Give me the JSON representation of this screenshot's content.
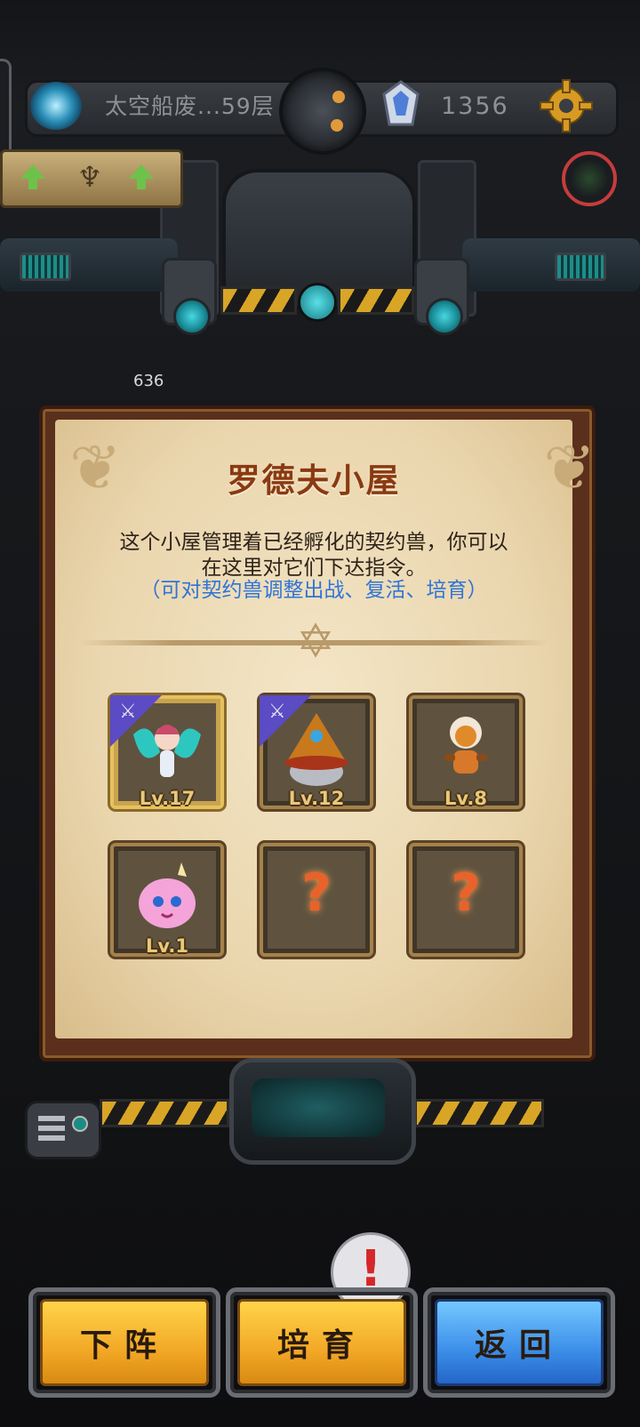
{
  "hud": {
    "floor_label": "太空船废...59层",
    "gold_amount": "1356",
    "scene_hp_number": "636"
  },
  "modal": {
    "title": "罗德夫小屋",
    "description_line1": "这个小屋管理着已经孵化的契约兽，你可以",
    "description_line2": "在这里对它们下达指令。",
    "hint": "（可对契约兽调整出战、复活、培育）"
  },
  "monsters": [
    {
      "name": "fairy-wing-monster",
      "level": "Lv.17",
      "deployed": true,
      "selected": true,
      "color": "#2ec7c0"
    },
    {
      "name": "wizard-hat-monster",
      "level": "Lv.12",
      "deployed": true,
      "selected": false,
      "color": "#c8791c"
    },
    {
      "name": "fire-monkey-monster",
      "level": "Lv.8",
      "deployed": false,
      "selected": false,
      "color": "#e08a2a"
    },
    {
      "name": "pink-puff-monster",
      "level": "Lv.1",
      "deployed": false,
      "selected": false,
      "color": "#f4a4d8"
    },
    {
      "name": "locked-slot",
      "level": "?",
      "deployed": false,
      "selected": false,
      "color": "#e9622a"
    },
    {
      "name": "locked-slot",
      "level": "?",
      "deployed": false,
      "selected": false,
      "color": "#e9622a"
    }
  ],
  "buttons": {
    "withdraw": "下阵",
    "train": "培育",
    "back": "返回"
  },
  "alert_symbol": "!"
}
